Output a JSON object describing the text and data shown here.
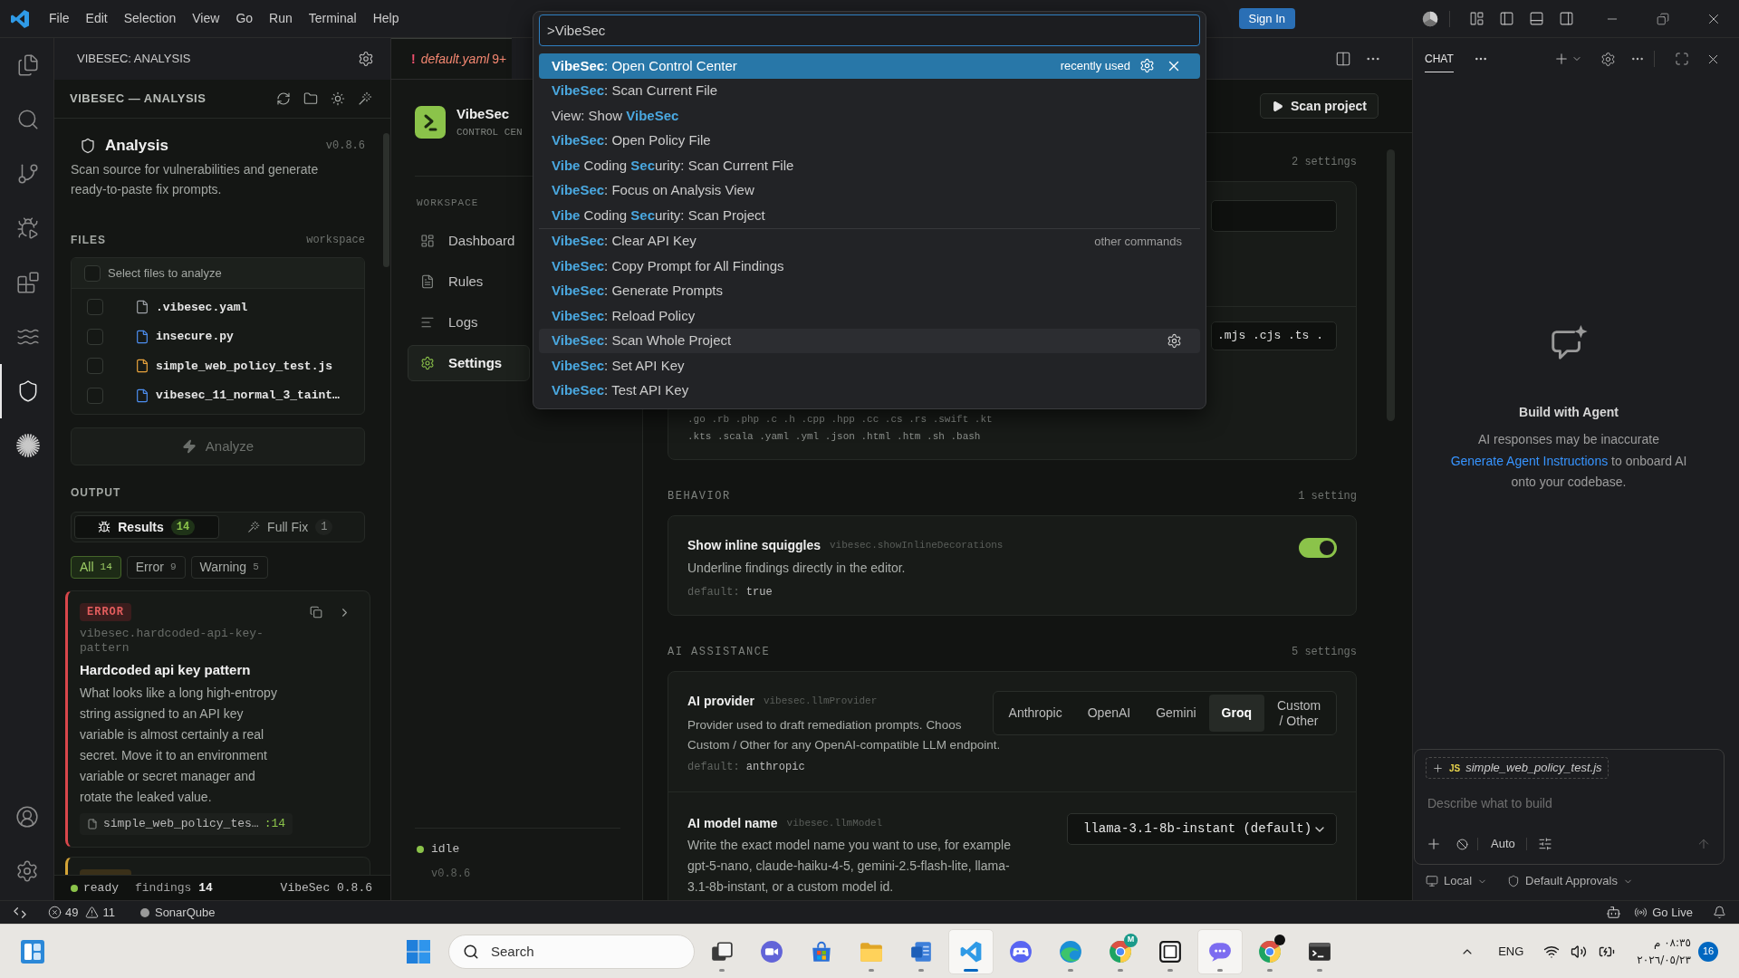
{
  "title_bar": {
    "menu": [
      "File",
      "Edit",
      "Selection",
      "View",
      "Go",
      "Run",
      "Terminal",
      "Help"
    ],
    "sign_in": "Sign In"
  },
  "command_palette": {
    "query": ">VibeSec",
    "groups": [
      {
        "label": "recently used",
        "items": [
          {
            "label": "**VibeSec**: Open Control Center",
            "selected": true,
            "hovered": false
          },
          {
            "label": "**VibeSec**: Scan Current File",
            "selected": false,
            "hovered": false
          },
          {
            "label": "View: Show **VibeSec**",
            "selected": false,
            "hovered": false
          },
          {
            "label": "**VibeSec**: Open Policy File",
            "selected": false,
            "hovered": false
          },
          {
            "label": "**Vibe** Coding **Sec**urity: Scan Current File",
            "selected": false,
            "hovered": false
          },
          {
            "label": "**VibeSec**: Focus on Analysis View",
            "selected": false,
            "hovered": false
          },
          {
            "label": "**Vibe** Coding **Sec**urity: Scan Project",
            "selected": false,
            "hovered": false
          }
        ]
      },
      {
        "label": "other commands",
        "items": [
          {
            "label": "**VibeSec**: Clear API Key",
            "selected": false,
            "hovered": false
          },
          {
            "label": "**VibeSec**: Copy Prompt for All Findings",
            "selected": false,
            "hovered": false
          },
          {
            "label": "**VibeSec**: Generate Prompts",
            "selected": false,
            "hovered": false
          },
          {
            "label": "**VibeSec**: Reload Policy",
            "selected": false,
            "hovered": false
          },
          {
            "label": "**VibeSec**: Scan Whole Project",
            "selected": false,
            "hovered": true
          },
          {
            "label": "**VibeSec**: Set API Key",
            "selected": false,
            "hovered": false
          },
          {
            "label": "**VibeSec**: Test API Key",
            "selected": false,
            "hovered": false
          }
        ]
      }
    ]
  },
  "activity_bar": {
    "top": [
      {
        "kind": "explorer",
        "selected": false
      },
      {
        "kind": "search",
        "selected": false
      },
      {
        "kind": "source-control",
        "selected": false
      },
      {
        "kind": "run-debug",
        "selected": false
      },
      {
        "kind": "extensions",
        "selected": false
      },
      {
        "kind": "waves",
        "selected": false
      },
      {
        "kind": "shield",
        "selected": true
      },
      {
        "kind": "starburst",
        "selected": false
      }
    ],
    "bottom": [
      {
        "kind": "account"
      },
      {
        "kind": "settings"
      }
    ]
  },
  "sidebar": {
    "title": "VIBESEC: ANALYSIS",
    "panel_title": "VIBESEC — ANALYSIS",
    "heading": "Analysis",
    "version": "v0.8.6",
    "description": "Scan source for vulnerabilities and generate ready-to-paste fix prompts.",
    "files": {
      "title": "FILES",
      "scope": "workspace",
      "select_all": {
        "label": "Select files to analyze",
        "checked": false
      },
      "items": [
        {
          "name": ".vibesec.yaml",
          "color": "#9da1a6",
          "checked": false
        },
        {
          "name": "insecure.py",
          "color": "#4d8ef0",
          "checked": false
        },
        {
          "name": "simple_web_policy_test.js",
          "color": "#e8a33d",
          "checked": false
        },
        {
          "name": "vibesec_11_normal_3_taint…",
          "color": "#4d8ef0",
          "checked": false
        }
      ]
    },
    "analyze": {
      "label": "Analyze",
      "disabled": true
    },
    "output": {
      "title": "OUTPUT",
      "tabs": [
        {
          "kind": "results",
          "label": "Results",
          "count": "14",
          "selected": true
        },
        {
          "kind": "full-fix",
          "label": "Full Fix",
          "count": "1",
          "selected": false
        }
      ],
      "filters": [
        {
          "label": "All",
          "count": "14",
          "selected": true
        },
        {
          "label": "Error",
          "count": "9",
          "selected": false
        },
        {
          "label": "Warning",
          "count": "5",
          "selected": false
        }
      ],
      "findings": [
        {
          "kind": "error",
          "badge": "ERROR",
          "rule": "vibesec.hardcoded-api-key-pattern",
          "title": "Hardcoded api key pattern",
          "description": "What looks like a long high-entropy string assigned to an API key variable is almost certainly a real secret. Move it to an environment variable or secret manager and rotate the leaked value.",
          "file": "simple_web_policy_tes…",
          "line": ":14"
        },
        {
          "kind": "warning"
        }
      ]
    },
    "status": {
      "state": "ready",
      "findings_label": "findings",
      "findings_count": "14",
      "version": "VibeSec 0.8.6"
    }
  },
  "editor": {
    "tabs": [
      {
        "glyph": "!",
        "label": "default.yaml",
        "badge": "9+",
        "selected": true
      }
    ],
    "control_center": {
      "brand": "VibeSec",
      "subtitle": "CONTROL CEN",
      "section": "WORKSPACE",
      "nav": [
        {
          "kind": "dashboard",
          "label": "Dashboard",
          "selected": false
        },
        {
          "kind": "rules",
          "label": "Rules",
          "selected": false
        },
        {
          "kind": "logs",
          "label": "Logs",
          "selected": false
        },
        {
          "kind": "settings",
          "label": "Settings",
          "selected": true
        }
      ],
      "status": "idle",
      "version": "v0.8.6",
      "scan_button": "Scan project",
      "sections": [
        {
          "count": "2 settings",
          "rows": [
            {
              "kind": "input"
            },
            {
              "kind": "input",
              "value": ".mjs .cjs .ts .",
              "default_lines": [
                ".go .rb .php .c .h .cpp .hpp .cc .cs .rs .swift .kt",
                ".kts .scala .yaml .yml .json .html .htm .sh .bash"
              ]
            }
          ]
        },
        {
          "title": "BEHAVIOR",
          "count": "1 setting",
          "rows": [
            {
              "kind": "toggle",
              "label": "Show inline squiggles",
              "key": "vibesec.showInlineDecorations",
              "description": "Underline findings directly in the editor.",
              "default_label": "default:",
              "default": "true",
              "on": true
            }
          ]
        },
        {
          "title": "AI ASSISTANCE",
          "count": "5 settings",
          "rows": [
            {
              "kind": "segmented",
              "label": "AI provider",
              "key": "vibesec.llmProvider",
              "description_lines": [
                "Provider used to draft remediation prompts. Choos",
                "Custom / Other for any OpenAI-compatible LLM endpoint."
              ],
              "options": [
                {
                  "label": "Anthropic",
                  "selected": false
                },
                {
                  "label": "OpenAI",
                  "selected": false
                },
                {
                  "label": "Gemini",
                  "selected": false
                },
                {
                  "label": "Groq",
                  "selected": true
                },
                {
                  "label": "Custom / Other",
                  "selected": false
                }
              ],
              "default_label": "default:",
              "default": "anthropic"
            },
            {
              "kind": "select",
              "label": "AI model name",
              "key": "vibesec.llmModel",
              "value": "llama-3.1-8b-instant (default)",
              "description": "Write the exact model name you want to use, for example gpt-5-nano, claude-haiku-4-5, gemini-2.5-flash-lite, llama-3.1-8b-instant, or a custom model id."
            }
          ]
        }
      ]
    }
  },
  "chat": {
    "tabs": [
      {
        "label": "CHAT",
        "selected": true
      }
    ],
    "empty_state": {
      "title": "Build with Agent",
      "note": "AI responses may be inaccurate",
      "link": "Generate Agent Instructions",
      "text": "to onboard AI onto your codebase."
    },
    "composer": {
      "attachment_type": "JS",
      "attachment": "simple_web_policy_test.js",
      "placeholder": "Describe what to build",
      "mode": "Auto"
    },
    "footer": [
      {
        "kind": "location",
        "label": "Local"
      },
      {
        "kind": "approvals",
        "label": "Default Approvals"
      }
    ]
  },
  "status_bar": {
    "errors": "49",
    "warnings": "11",
    "sonar": "SonarQube",
    "go_live": "Go Live"
  },
  "taskbar": {
    "search": {
      "placeholder": "Search"
    },
    "apps": [
      {
        "kind": "task-view",
        "running": true,
        "selected": false,
        "hovered": false
      },
      {
        "kind": "video-chat",
        "running": false,
        "selected": false,
        "hovered": false
      },
      {
        "kind": "store",
        "running": false,
        "selected": false,
        "hovered": false
      },
      {
        "kind": "folder",
        "running": true,
        "selected": false,
        "hovered": false
      },
      {
        "kind": "document",
        "running": true,
        "selected": false,
        "hovered": false
      },
      {
        "kind": "code-editor",
        "running": true,
        "selected": true,
        "hovered": false
      },
      {
        "kind": "gamepad",
        "running": false,
        "selected": false,
        "hovered": false
      },
      {
        "kind": "swirl",
        "running": true,
        "selected": false,
        "hovered": false
      },
      {
        "kind": "browser",
        "badge": "M",
        "running": true,
        "selected": false,
        "hovered": false
      },
      {
        "kind": "tile",
        "running": true,
        "selected": false,
        "hovered": false
      },
      {
        "kind": "chat-app",
        "running": true,
        "selected": false,
        "hovered": true
      },
      {
        "kind": "browser",
        "avatar": true,
        "running": true,
        "selected": false,
        "hovered": false
      },
      {
        "kind": "terminal",
        "running": true,
        "selected": false,
        "hovered": false
      }
    ],
    "tray": {
      "language": "ENG",
      "time": "٠٨:٣٥ م",
      "date": "٢٠٢٦/٠٥/٢٣",
      "notifications": "16"
    }
  }
}
